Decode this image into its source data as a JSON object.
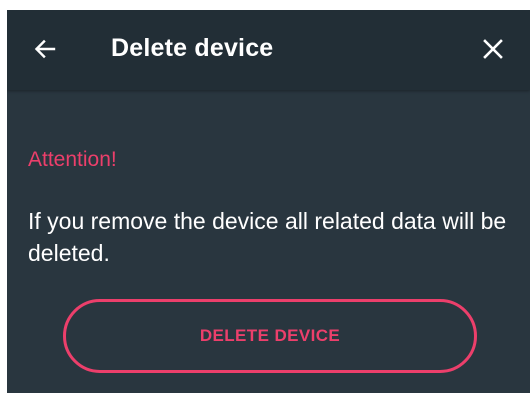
{
  "header": {
    "title": "Delete device",
    "back_icon": "arrow-left-icon",
    "close_icon": "close-icon"
  },
  "content": {
    "attention": "Attention!",
    "message": "If you remove the device all related data will be deleted."
  },
  "actions": {
    "delete_label": "DELETE DEVICE"
  },
  "colors": {
    "background": "#29363f",
    "appbar": "#222e36",
    "accent": "#ec3f6b",
    "text": "#ffffff"
  }
}
